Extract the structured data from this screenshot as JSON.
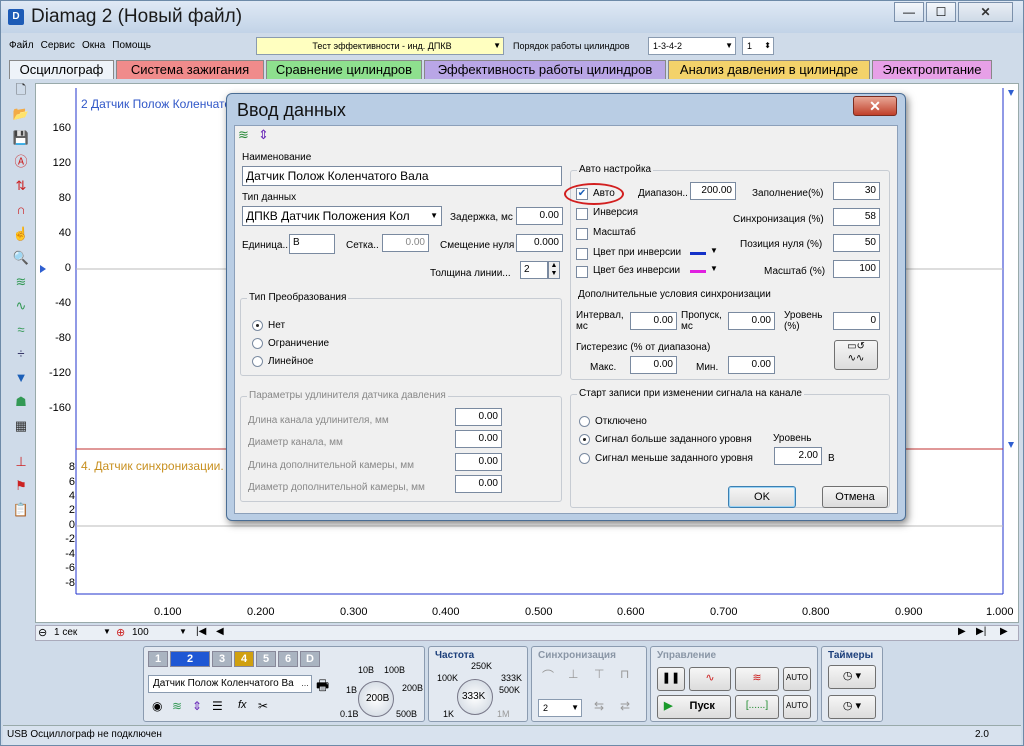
{
  "window": {
    "title": "Diamag 2 (Новый файл)",
    "icon": "app-icon"
  },
  "menu": {
    "items": [
      "Файл",
      "Сервис",
      "Окна",
      "Помощь"
    ]
  },
  "test_combo": {
    "value": "Тест эффективности - инд. ДПКВ"
  },
  "cylinder_order": {
    "label": "Порядок работы цилиндров",
    "value": "1-3-4-2",
    "spin_value": "1"
  },
  "tabs": [
    {
      "label": "Осциллограф",
      "color": "#eef3f9"
    },
    {
      "label": "Система зажигания",
      "color": "#f08b8b"
    },
    {
      "label": "Сравнение цилиндров",
      "color": "#8ee08e"
    },
    {
      "label": "Эффективность работы цилиндров",
      "color": "#b9a6e6"
    },
    {
      "label": "Анализ давления в цилиндре",
      "color": "#f3d26a"
    },
    {
      "label": "Электропитание",
      "color": "#e7a0e7"
    }
  ],
  "plot": {
    "ch2_label": "2 Датчик Полож Коленчатого Вала",
    "ch4_label": "4. Датчик синхронизации. (",
    "y_upper": [
      "160",
      "120",
      "80",
      "40",
      "0",
      "-40",
      "-80",
      "-120",
      "-160"
    ],
    "y_lower": [
      "8",
      "6",
      "4",
      "2",
      "0",
      "-2",
      "-4",
      "-6",
      "-8"
    ],
    "x_ticks": [
      "0.100",
      "0.200",
      "0.300",
      "0.400",
      "0.500",
      "0.600",
      "0.700",
      "0.800",
      "0.900",
      "1.000"
    ],
    "grid_color": "#2233cc"
  },
  "bottom": {
    "time_scale": "1 сек",
    "zoom": "100",
    "channels": [
      "1",
      "2",
      "3",
      "4",
      "5",
      "6",
      "D"
    ],
    "channel_name": "Датчик Полож Коленчатого Ва",
    "freq_title": "Частота",
    "sync_title": "Синхронизация",
    "control_title": "Управление",
    "timers_title": "Таймеры",
    "knob1_labels": [
      "10В",
      "100В",
      "1В",
      "200В",
      "0.1В",
      "500В"
    ],
    "knob1_value": "200В",
    "knob2_labels": [
      "250K",
      "100K",
      "333K",
      "500K",
      "1K",
      "1M"
    ],
    "knob2_value": "333K",
    "sync_value": "2",
    "start_label": "Пуск",
    "ellipsis_btn": "[......]"
  },
  "status": {
    "text": "USB Осциллограф не подключен",
    "version": "2.0"
  },
  "dialog": {
    "title": "Ввод данных",
    "name_label": "Наименование",
    "name_value": "Датчик Полож Коленчатого Вала",
    "type_label": "Тип данных",
    "type_value": "ДПКВ Датчик Положения Кол",
    "delay_label": "Задержка, мс",
    "delay_value": "0.00",
    "unit_label": "Единица..",
    "unit_value": "В",
    "grid_label": "Сетка..",
    "grid_value": "0.00",
    "zero_shift_label": "Смещение нуля",
    "zero_shift_value": "0.000",
    "line_width_label": "Толщина линии...",
    "line_width_value": "2",
    "conversion_title": "Тип Преобразования",
    "conversion_options": [
      "Нет",
      "Ограничение",
      "Линейное"
    ],
    "extender_title": "Параметры удлинителя датчика давления",
    "extender_fields": [
      {
        "label": "Длина канала удлинителя, мм",
        "value": "0.00"
      },
      {
        "label": "Диаметр канала, мм",
        "value": "0.00"
      },
      {
        "label": "Длина дополнительной камеры, мм",
        "value": "0.00"
      },
      {
        "label": "Диаметр дополнительной камеры, мм",
        "value": "0.00"
      }
    ],
    "auto_title": "Авто настройка",
    "auto_label": "Авто",
    "range_label": "Диапазон..",
    "range_value": "200.00",
    "inversion_label": "Инверсия",
    "scale_cb_label": "Масштаб",
    "color_inv_label": "Цвет при инверсии",
    "color_noinv_label": "Цвет без инверсии",
    "fill_label": "Заполнение(%)",
    "fill_value": "30",
    "sync_label": "Синхронизация (%)",
    "sync_value": "58",
    "zero_pos_label": "Позиция нуля (%)",
    "zero_pos_value": "50",
    "scale_label": "Масштаб (%)",
    "scale_value": "100",
    "extra_sync_title": "Дополнительные условия синхронизации",
    "interval_label": "Интервал, мс",
    "interval_value": "0.00",
    "skip_label": "Пропуск, мс",
    "skip_value": "0.00",
    "level_label": "Уровень (%)",
    "level_value": "0",
    "hysteresis_label": "Гистерезис (% от диапазона)",
    "max_label": "Макс.",
    "max_value": "0.00",
    "min_label": "Мин.",
    "min_value": "0.00",
    "start_title": "Старт записи при изменении сигнала на канале",
    "start_options": [
      "Отключено",
      "Сигнал больше заданного уровня",
      "Сигнал меньше заданного уровня"
    ],
    "start_level_label": "Уровень",
    "start_level_value": "2.00",
    "start_level_unit": "В",
    "ok_label": "OK",
    "cancel_label": "Отмена"
  }
}
